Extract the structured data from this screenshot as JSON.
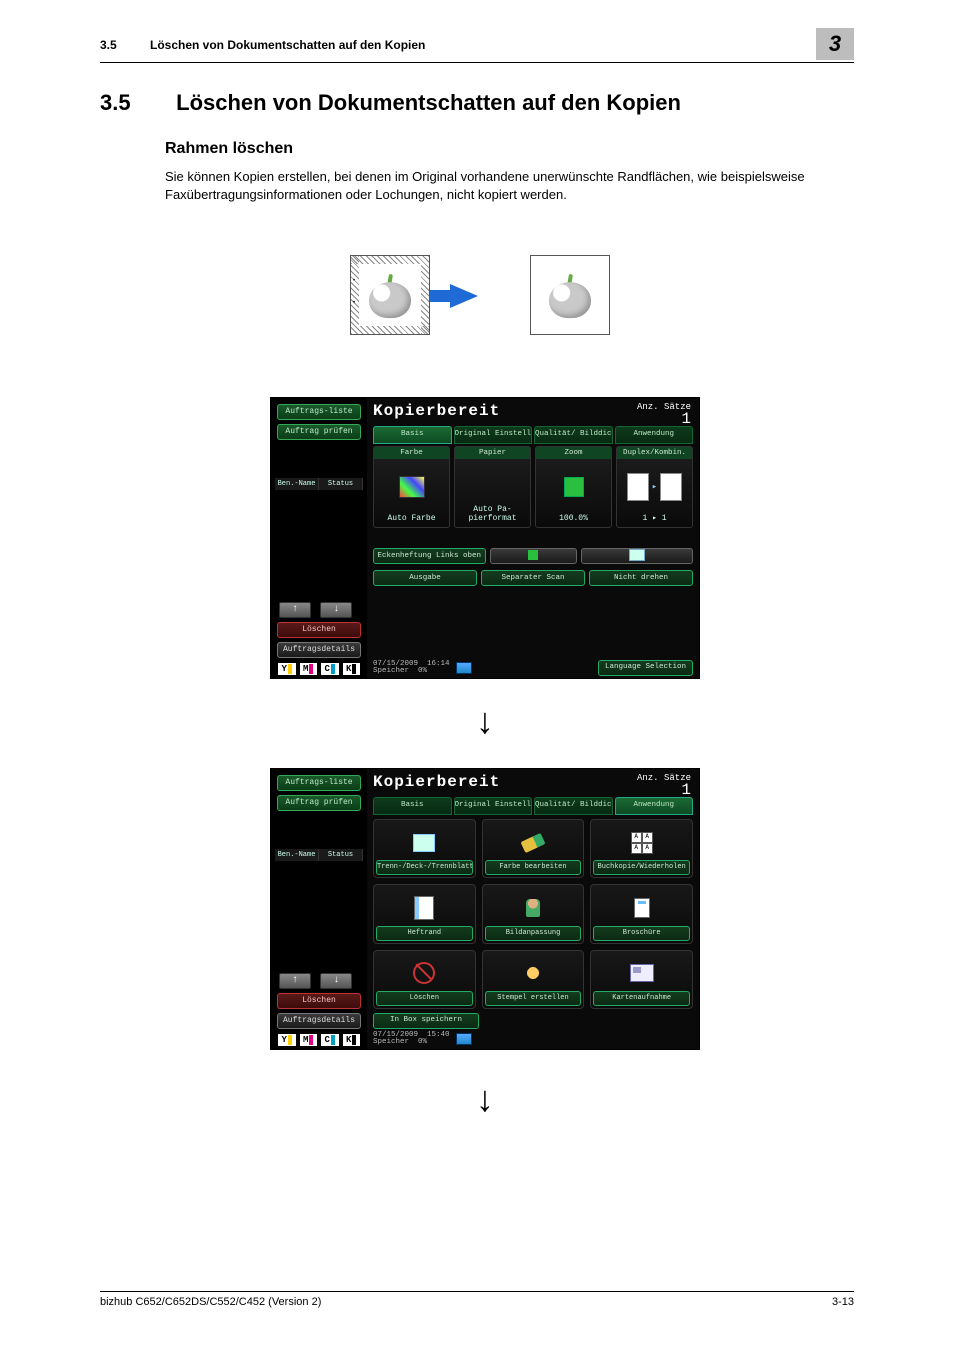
{
  "running_header": {
    "section": "3.5",
    "title": "Löschen von Dokumentschatten auf den Kopien"
  },
  "chapter_badge": "3",
  "heading": {
    "number": "3.5",
    "title": "Löschen von Dokumentschatten auf den Kopien"
  },
  "subheading": "Rahmen löschen",
  "body_text": "Sie können Kopien erstellen, bei denen im Original vorhandene unerwünschte Randflächen, wie beispielsweise Faxübertragungsinformationen oder Lochungen, nicht kopiert werden.",
  "panel": {
    "ready": "Kopierbereit",
    "sets_label": "Anz. Sätze",
    "sets_value": "1",
    "side": {
      "job_list": "Auftrags-liste",
      "check_job": "Auftrag prüfen",
      "ben": "Ben.-Name",
      "status": "Status",
      "delete": "Löschen",
      "details": "Auftragsdetails"
    },
    "tabs": [
      "Basis",
      "Original Einstellung",
      "Qualität/ Bilddichte",
      "Anwendung"
    ],
    "grid": {
      "farbe": {
        "h": "Farbe",
        "v": "Auto Farbe"
      },
      "papier": {
        "h": "Papier",
        "v": "Auto Pa-pierformat"
      },
      "zoom": {
        "h": "Zoom",
        "v": "100.0%"
      },
      "duplex": {
        "h": "Duplex/Kombin.",
        "v": "1 ▸ 1"
      }
    },
    "row_eck": {
      "a": "Eckenheftung Links oben",
      "b": "",
      "c": ""
    },
    "row_out": {
      "a": "Ausgabe",
      "b": "Separater Scan",
      "c": "Nicht drehen"
    },
    "datetime1": {
      "date": "07/15/2009",
      "time": "16:14",
      "mem_lbl": "Speicher",
      "mem": "0%"
    },
    "datetime2": {
      "date": "07/15/2009",
      "time": "15:40",
      "mem_lbl": "Speicher",
      "mem": "0%"
    },
    "language": "Language Selection",
    "toner": [
      "Y",
      "M",
      "C",
      "K"
    ]
  },
  "apps": [
    "Trenn-/Deck-/Trennblatt",
    "Farbe bearbeiten",
    "Buchkopie/Wiederholen",
    "Heftrand",
    "Bildanpassung",
    "Broschüre",
    "Löschen",
    "Stempel erstellen",
    "Kartenaufnahme"
  ],
  "inbox": "In Box speichern",
  "footer": {
    "left": "bizhub C652/C652DS/C552/C452 (Version 2)",
    "right": "3-13"
  }
}
